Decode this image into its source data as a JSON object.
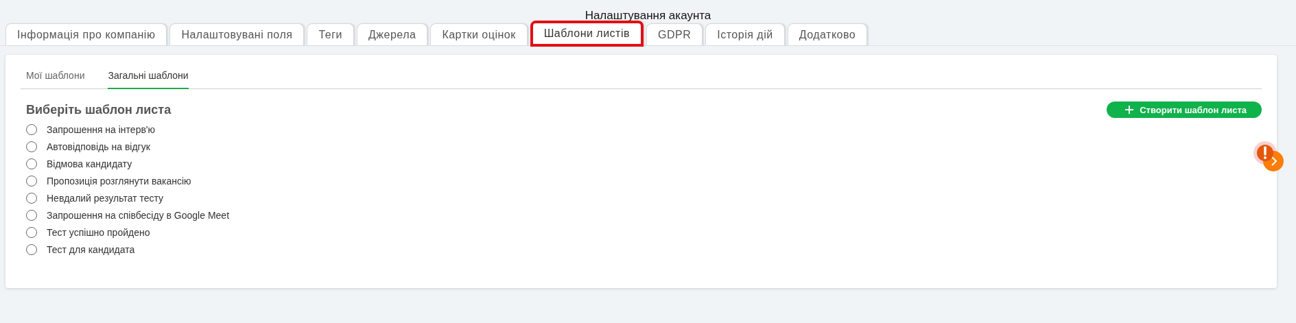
{
  "window": {
    "title": "Налаштування акаунта"
  },
  "tabs": [
    {
      "label": "Інформація про компанію",
      "selected": false
    },
    {
      "label": "Налаштовувані поля",
      "selected": false
    },
    {
      "label": "Теги",
      "selected": false
    },
    {
      "label": "Джерела",
      "selected": false
    },
    {
      "label": "Картки оцінок",
      "selected": false
    },
    {
      "label": "Шаблони листів",
      "selected": true
    },
    {
      "label": "GDPR",
      "selected": false
    },
    {
      "label": "Історія дій",
      "selected": false
    },
    {
      "label": "Додатково",
      "selected": false
    }
  ],
  "subtabs": [
    {
      "label": "Мої шаблони",
      "selected": false
    },
    {
      "label": "Загальні шаблони",
      "selected": true
    }
  ],
  "heading": "Виберіть шаблон листа",
  "create_button": {
    "label": "Створити шаблон листа"
  },
  "templates": [
    {
      "label": "Запрошення на інтерв'ю",
      "selected": false
    },
    {
      "label": "Автовідповідь на відгук",
      "selected": false
    },
    {
      "label": "Відмова кандидату",
      "selected": false
    },
    {
      "label": "Пропозиція розглянути вакансію",
      "selected": false
    },
    {
      "label": "Невдалий результат тесту",
      "selected": false
    },
    {
      "label": "Запрошення на співбесіду в Google Meet",
      "selected": false
    },
    {
      "label": "Тест успішно пройдено",
      "selected": false
    },
    {
      "label": "Тест для кандидата",
      "selected": false
    }
  ]
}
